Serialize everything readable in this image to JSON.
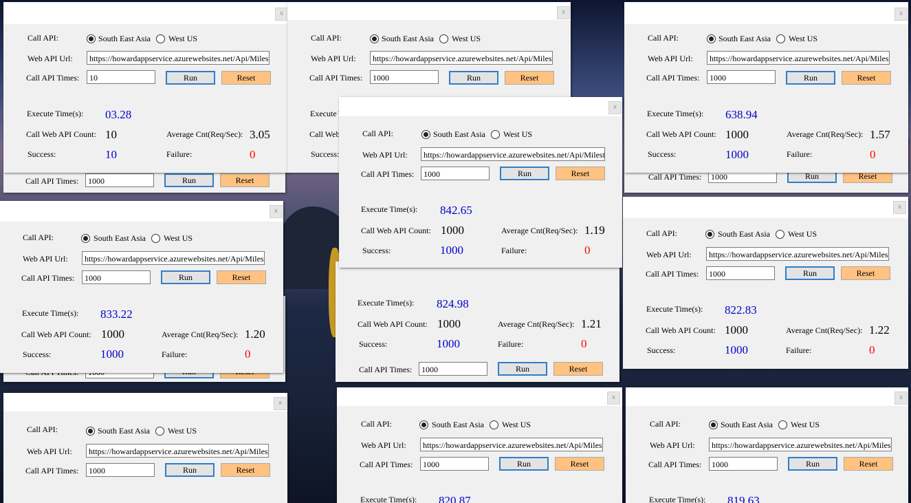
{
  "labels": {
    "call_api": "Call API:",
    "region_sea": "South East Asia",
    "region_wus": "West US",
    "web_api_url": "Web API Url:",
    "call_api_times": "Call API Times:",
    "run": "Run",
    "reset": "Reset",
    "execute_time": "Execute Time(s):",
    "call_count": "Call Web API Count:",
    "average": "Average Cnt(Req/Sec):",
    "success": "Success:",
    "failure": "Failure:",
    "close_glyph": "x"
  },
  "url": "https://howardappservice.azurewebsites.net/Api/Mileston",
  "colors": {
    "value_blue": "#0000cc",
    "value_red": "#ff0000",
    "run_border": "#2f7ec7",
    "reset_bg": "#ffc281"
  },
  "windows": [
    {
      "times": "1000"
    },
    {
      "times": "1000"
    },
    {
      "times": "1000"
    },
    {
      "times": "10",
      "execute_time": "03.28",
      "call_count": "10",
      "average": "3.05",
      "success": "10",
      "failure": "0"
    },
    {
      "times": "1000"
    },
    {
      "times": "1000",
      "execute_time": "638.94",
      "call_count": "1000",
      "average": "1.57",
      "success": "1000",
      "failure": "0"
    },
    {
      "times": "1000",
      "execute_time": "824.98",
      "call_count": "1000",
      "average": "1.21",
      "success": "1000",
      "failure": "0"
    },
    {
      "times": "1000",
      "execute_time": "842.65",
      "call_count": "1000",
      "average": "1.19",
      "success": "1000",
      "failure": "0"
    },
    {
      "times": "1000",
      "execute_time": "833.22",
      "call_count": "1000",
      "average": "1.20",
      "success": "1000",
      "failure": "0"
    },
    {
      "times": "1000",
      "execute_time": "822.83",
      "call_count": "1000",
      "average": "1.22",
      "success": "1000",
      "failure": "0"
    },
    {
      "times": "1000"
    },
    {
      "times": "1000",
      "execute_time": "820.87"
    },
    {
      "times": "1000",
      "execute_time": "819.63"
    }
  ]
}
